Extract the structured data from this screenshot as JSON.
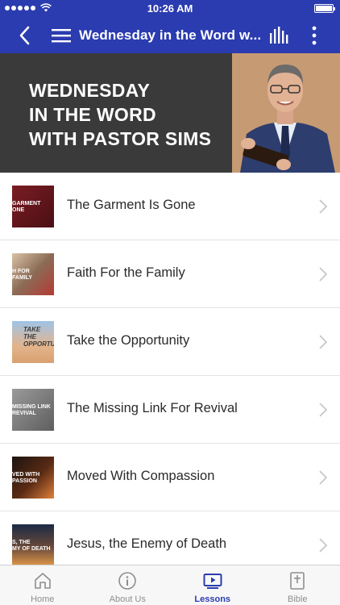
{
  "status_bar": {
    "time": "10:26 AM"
  },
  "nav": {
    "title": "Wednesday in the Word w..."
  },
  "banner": {
    "line1": "WEDNESDAY",
    "line2": "IN THE WORD",
    "line3": "WITH PASTOR SIMS"
  },
  "lessons": [
    {
      "title": "The Garment Is Gone",
      "thumb_text": "GARMENT\nONE"
    },
    {
      "title": "Faith For the Family",
      "thumb_text": "H FOR\nFAMILY"
    },
    {
      "title": "Take the Opportunity",
      "thumb_text": "TAKE\nTHE\nOPPORTUNITY"
    },
    {
      "title": "The Missing Link For Revival",
      "thumb_text": "MISSING LINK\nREVIVAL"
    },
    {
      "title": "Moved With Compassion",
      "thumb_text": "VED WITH\nPASSION"
    },
    {
      "title": "Jesus, the Enemy of Death",
      "thumb_text": "S, THE\nMY OF DEATH"
    }
  ],
  "tabs": [
    {
      "label": "Home",
      "icon": "home-icon"
    },
    {
      "label": "About Us",
      "icon": "info-icon"
    },
    {
      "label": "Lessons",
      "icon": "play-icon"
    },
    {
      "label": "Bible",
      "icon": "bible-icon"
    }
  ],
  "colors": {
    "accent": "#2b3bb0",
    "banner_bg": "#3a3a3a",
    "tab_inactive": "#8e8e8e"
  }
}
